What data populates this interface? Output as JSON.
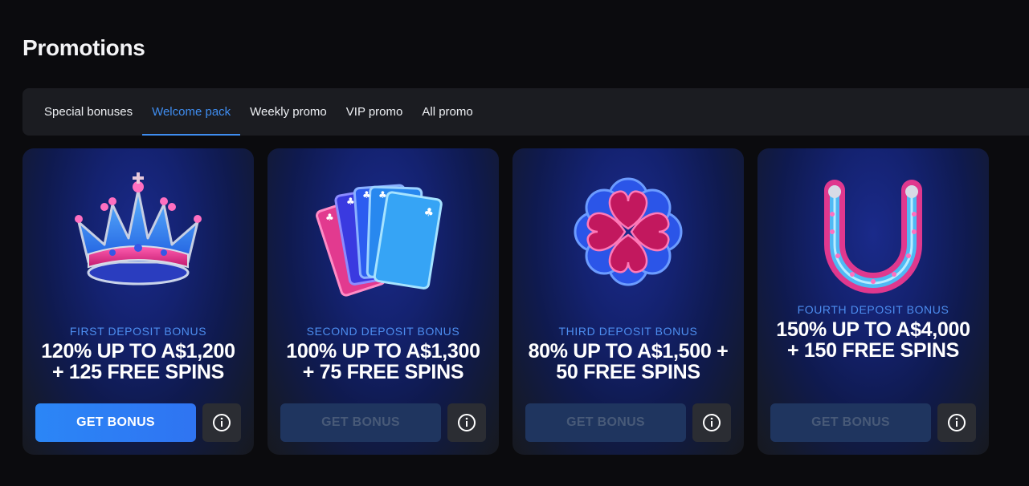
{
  "page": {
    "title": "Promotions"
  },
  "tabs": [
    {
      "label": "Special bonuses",
      "active": false
    },
    {
      "label": "Welcome pack",
      "active": true
    },
    {
      "label": "Weekly promo",
      "active": false
    },
    {
      "label": "VIP promo",
      "active": false
    },
    {
      "label": "All promo",
      "active": false
    }
  ],
  "cards": [
    {
      "icon": "crown-icon",
      "label": "FIRST DEPOSIT BONUS",
      "title": "120% UP TO A$1,200 + 125 FREE SPINS",
      "button": "GET BONUS",
      "button_enabled": true
    },
    {
      "icon": "playing-cards-icon",
      "label": "SECOND DEPOSIT BONUS",
      "title": "100% UP TO A$1,300 + 75 FREE SPINS",
      "button": "GET BONUS",
      "button_enabled": false
    },
    {
      "icon": "four-leaf-clover-icon",
      "label": "THIRD DEPOSIT BONUS",
      "title": "80% UP TO A$1,500 + 50 FREE SPINS",
      "button": "GET BONUS",
      "button_enabled": false
    },
    {
      "icon": "horseshoe-icon",
      "label": "FOURTH DEPOSIT BONUS",
      "title": "150% UP TO A$4,000 + 150 FREE SPINS",
      "button": "GET BONUS",
      "button_enabled": false
    }
  ],
  "colors": {
    "background": "#0b0b0e",
    "tab_active": "#3f8df0",
    "bonus_label": "#4d8ef0",
    "button_primary": "#2b86f6",
    "button_disabled": "#1f355f"
  }
}
